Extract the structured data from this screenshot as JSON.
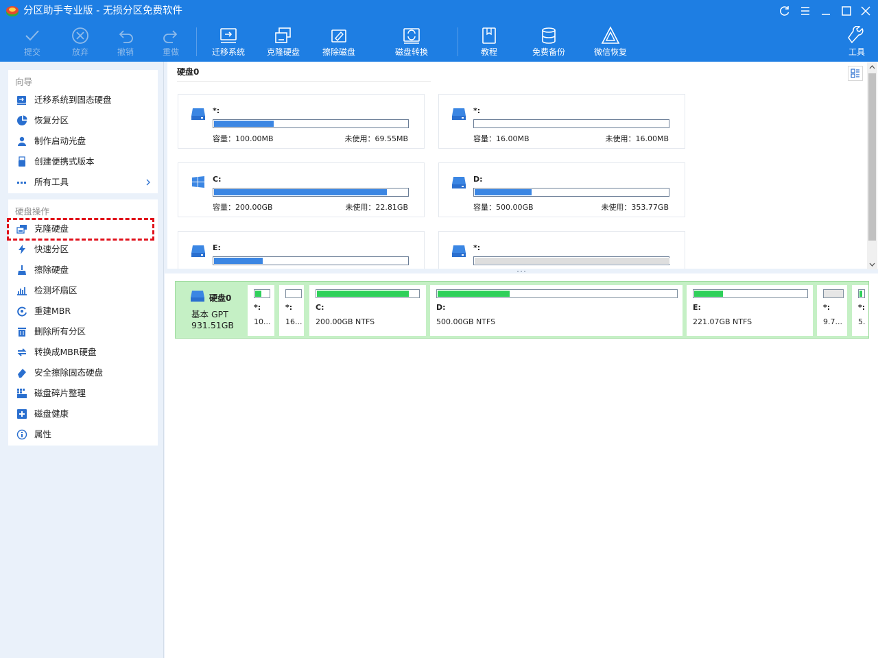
{
  "window": {
    "title": "分区助手专业版 - 无损分区免费软件",
    "controls": [
      "refresh-icon",
      "menu-icon",
      "minimize-icon",
      "maximize-icon",
      "close-icon"
    ]
  },
  "toolbar": {
    "submit": "提交",
    "discard": "放弃",
    "undo": "撤销",
    "redo": "重做",
    "migrate": "迁移系统",
    "clone": "克隆硬盘",
    "wipe": "擦除磁盘",
    "convert": "磁盘转换",
    "tutorial": "教程",
    "backup": "免费备份",
    "wechat": "微信恢复",
    "tools": "工具"
  },
  "sidebar": {
    "wizard_title": "向导",
    "wizard_items": [
      {
        "label": "迁移系统到固态硬盘",
        "icon": "migrate-ssd-icon"
      },
      {
        "label": "恢复分区",
        "icon": "recover-partition-icon"
      },
      {
        "label": "制作启动光盘",
        "icon": "bootable-media-icon"
      },
      {
        "label": "创建便携式版本",
        "icon": "portable-version-icon"
      },
      {
        "label": "所有工具",
        "icon": "all-tools-icon"
      }
    ],
    "disk_ops_title": "硬盘操作",
    "disk_ops_items": [
      {
        "label": "克隆硬盘",
        "icon": "clone-disk-icon"
      },
      {
        "label": "快速分区",
        "icon": "quick-partition-icon"
      },
      {
        "label": "擦除硬盘",
        "icon": "wipe-disk-icon"
      },
      {
        "label": "检测坏扇区",
        "icon": "bad-sector-icon"
      },
      {
        "label": "重建MBR",
        "icon": "rebuild-mbr-icon"
      },
      {
        "label": "删除所有分区",
        "icon": "delete-partitions-icon"
      },
      {
        "label": "转换成MBR硬盘",
        "icon": "convert-mbr-icon"
      },
      {
        "label": "安全擦除固态硬盘",
        "icon": "secure-erase-icon"
      },
      {
        "label": "磁盘碎片整理",
        "icon": "defrag-icon"
      },
      {
        "label": "磁盘健康",
        "icon": "disk-health-icon"
      },
      {
        "label": "属性",
        "icon": "properties-icon"
      }
    ]
  },
  "disk_panel": {
    "title": "硬盘0",
    "partitions": [
      {
        "name": "*:",
        "capacity": "容量：100.00MB",
        "free": "未使用：69.55MB",
        "used_fraction": 0.305,
        "icon": "drive-icon"
      },
      {
        "name": "*:",
        "capacity": "容量：16.00MB",
        "free": "未使用：16.00MB",
        "used_fraction": 0.0,
        "icon": "drive-icon"
      },
      {
        "name": "C:",
        "capacity": "容量：200.00GB",
        "free": "未使用：22.81GB",
        "used_fraction": 0.886,
        "icon": "windows-icon"
      },
      {
        "name": "D:",
        "capacity": "容量：500.00GB",
        "free": "未使用：353.77GB",
        "used_fraction": 0.292,
        "icon": "drive-icon"
      },
      {
        "name": "E:",
        "capacity": "",
        "free": "",
        "used_fraction": 0.25,
        "icon": "drive-icon"
      },
      {
        "name": "*:",
        "capacity": "",
        "free": "",
        "used_fraction": 0.0,
        "icon": "drive-icon"
      }
    ]
  },
  "disk_map": {
    "name": "硬盘0",
    "type": "基本 GPT",
    "size": "931.51GB",
    "segments": [
      {
        "name": "*:",
        "size": "10...",
        "used_fraction": 0.4
      },
      {
        "name": "*:",
        "size": "16...",
        "used_fraction": 0.0
      },
      {
        "name": "C:",
        "size": "200.00GB NTFS",
        "used_fraction": 0.89
      },
      {
        "name": "D:",
        "size": "500.00GB NTFS",
        "used_fraction": 0.3
      },
      {
        "name": "E:",
        "size": "221.07GB NTFS",
        "used_fraction": 0.25
      },
      {
        "name": "*:",
        "size": "9.7...",
        "used_fraction": 0.0
      },
      {
        "name": "*:",
        "size": "5.",
        "used_fraction": 0.5
      }
    ]
  },
  "colors": {
    "accent": "#1e7ee3",
    "bar_fill": "#3b86e3",
    "map_fill": "#2fd05a",
    "map_background": "#c5f0c5",
    "highlight": "#e0101a"
  }
}
